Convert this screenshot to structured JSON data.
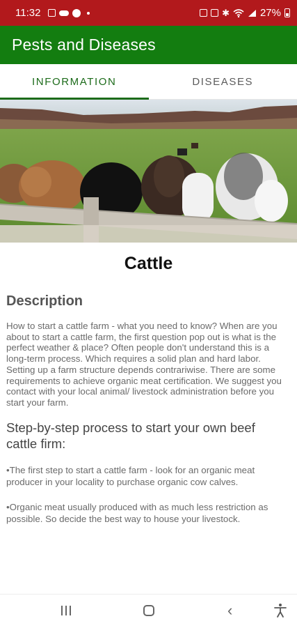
{
  "status_bar": {
    "time": "11:32",
    "battery": "27%"
  },
  "app_bar": {
    "title": "Pests and Diseases"
  },
  "tabs": [
    {
      "label": "INFORMATION",
      "active": true
    },
    {
      "label": "DISEASES",
      "active": false
    }
  ],
  "hero": {
    "icon": "cattle-photo"
  },
  "content": {
    "title": "Cattle",
    "description_heading": "Description",
    "description": "How to start a cattle farm - what you need to know? When are you about to start a cattle farm, the first question pop out is what is the perfect weather & place? Often people don't understand this is a long-term process. Which requires a solid plan and hard labor. Setting up a farm structure depends contrariwise. There are some requirements to achieve organic meat certification. We suggest you contact with your local animal/ livestock administration before you start your farm.",
    "steps_heading": "Step-by-step process to start your own beef cattle firm:",
    "steps": [
      "•The first step to start a cattle farm  - look for an organic meat producer in your locality to purchase organic cow calves.",
      "•Organic meat usually produced with as much less restriction as possible. So decide the best way to house your livestock."
    ]
  },
  "colors": {
    "status_bar": "#b2191c",
    "app_bar": "#137d10",
    "tab_active": "#1c6b1a"
  }
}
